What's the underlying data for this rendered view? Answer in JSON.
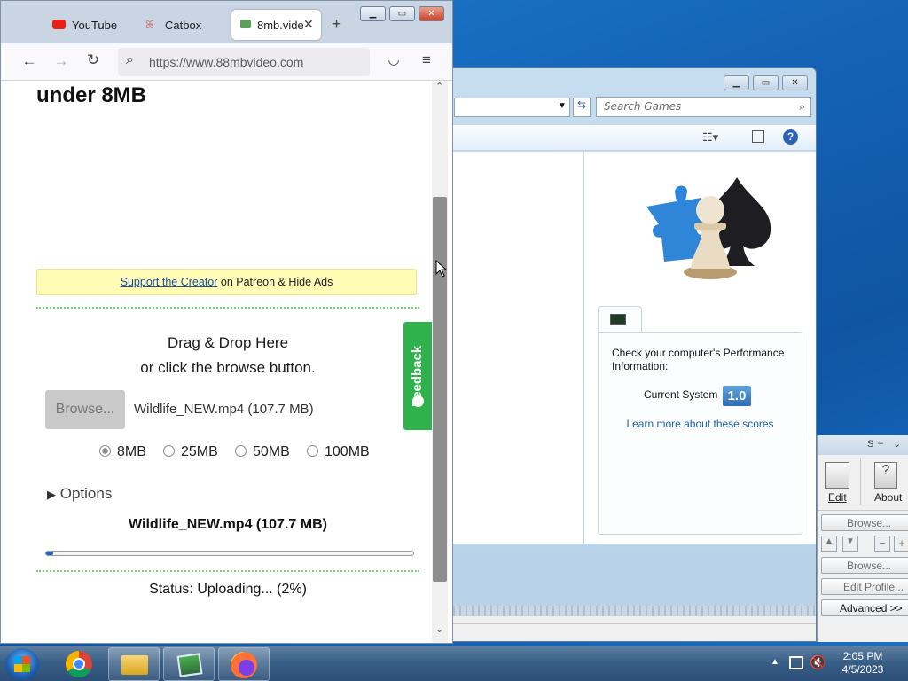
{
  "browser": {
    "tabs": [
      {
        "label": "YouTube",
        "icon": "youtube-icon"
      },
      {
        "label": "Catbox",
        "icon": "catbox-icon"
      },
      {
        "label": "8mb.vide",
        "icon": "8mb-icon",
        "active": true
      }
    ],
    "url": "https://www.88mbvideo.com"
  },
  "page": {
    "heading": "under 8MB",
    "ad_link": "Support the Creator",
    "ad_text": " on Patreon & Hide Ads",
    "drop_line1": "Drag & Drop Here",
    "drop_line2": "or click the browse button.",
    "browse_label": "Browse...",
    "file_info": "Wildlife_NEW.mp4 (107.7 MB)",
    "sizes": [
      {
        "label": "8MB",
        "selected": true
      },
      {
        "label": "25MB",
        "selected": false
      },
      {
        "label": "50MB",
        "selected": false
      },
      {
        "label": "100MB",
        "selected": false
      }
    ],
    "options_label": "Options",
    "current_file": "Wildlife_NEW.mp4 (107.7 MB)",
    "progress_fraction": 0.02,
    "status": "Status: Uploading... (2%)",
    "feedback_label": "Feedback"
  },
  "games_window": {
    "search_placeholder": "Search Games",
    "perf_text": "Check your computer's Performance Information:",
    "current_system_label": "Current System",
    "score": "1.0",
    "learn_more": "Learn more about these scores"
  },
  "third_window": {
    "title_fragment": "S",
    "edit_label": "Edit",
    "about_label": "About",
    "browse_1": "Browse...",
    "browse_2": "Browse...",
    "edit_profile": "Edit Profile...",
    "advanced": "Advanced >>"
  },
  "taskbar": {
    "time": "2:05 PM",
    "date": "4/5/2023"
  },
  "colors": {
    "feedback_green": "#2fb24c",
    "ad_yellow": "#fffcb6",
    "progress_blue": "#2a64b8",
    "desktop_blue": "#1565b8"
  }
}
